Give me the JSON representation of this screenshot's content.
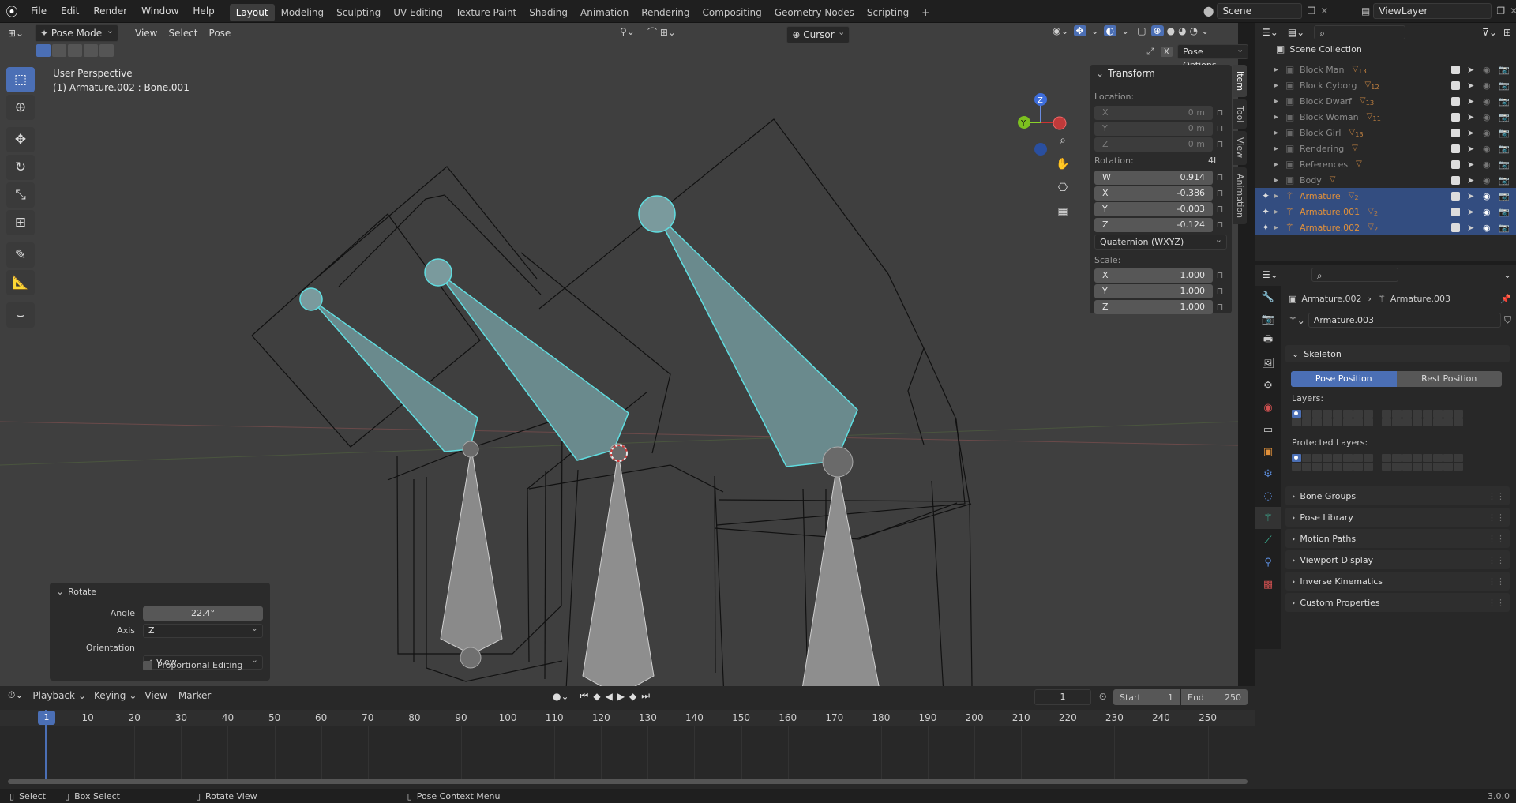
{
  "top_menu": {
    "items": [
      "File",
      "Edit",
      "Render",
      "Window",
      "Help"
    ],
    "workspaces": [
      "Layout",
      "Modeling",
      "Sculpting",
      "UV Editing",
      "Texture Paint",
      "Shading",
      "Animation",
      "Rendering",
      "Compositing",
      "Geometry Nodes",
      "Scripting"
    ],
    "active_workspace": "Layout",
    "scene": "Scene",
    "view_layer": "ViewLayer"
  },
  "viewport_header": {
    "mode": "Pose Mode",
    "menus": [
      "View",
      "Select",
      "Pose"
    ],
    "pivot": "Cursor",
    "pose_options": "Pose Options"
  },
  "viewport": {
    "view_name": "User Perspective",
    "object_info": "(1) Armature.002 : Bone.001",
    "gizmo_labels": {
      "z": "Z",
      "y": "Y"
    }
  },
  "npanel": {
    "title": "Transform",
    "location_label": "Location:",
    "location": [
      {
        "axis": "X",
        "value": "0 m"
      },
      {
        "axis": "Y",
        "value": "0 m"
      },
      {
        "axis": "Z",
        "value": "0 m"
      }
    ],
    "rotation_label": "Rotation:",
    "rotation_mode_tag": "4L",
    "rotation": [
      {
        "axis": "W",
        "value": "0.914"
      },
      {
        "axis": "X",
        "value": "-0.386"
      },
      {
        "axis": "Y",
        "value": "-0.003"
      },
      {
        "axis": "Z",
        "value": "-0.124"
      }
    ],
    "rotation_mode": "Quaternion (WXYZ)",
    "scale_label": "Scale:",
    "scale": [
      {
        "axis": "X",
        "value": "1.000"
      },
      {
        "axis": "Y",
        "value": "1.000"
      },
      {
        "axis": "Z",
        "value": "1.000"
      }
    ],
    "tabs": [
      "Item",
      "Tool",
      "View",
      "Animation"
    ]
  },
  "operator_panel": {
    "title": "Rotate",
    "angle_label": "Angle",
    "angle": "22.4°",
    "axis_label": "Axis",
    "axis": "Z",
    "orientation_label": "Orientation",
    "orientation": "View",
    "proportional": "Proportional Editing"
  },
  "outliner": {
    "root": "Scene Collection",
    "items": [
      {
        "name": "Block Man",
        "count": "13",
        "selected": false
      },
      {
        "name": "Block Cyborg",
        "count": "12",
        "selected": false
      },
      {
        "name": "Block Dwarf",
        "count": "13",
        "selected": false
      },
      {
        "name": "Block Woman",
        "count": "11",
        "selected": false
      },
      {
        "name": "Block Girl",
        "count": "13",
        "selected": false
      },
      {
        "name": "Rendering",
        "count": "",
        "selected": false
      },
      {
        "name": "References",
        "count": "",
        "selected": false
      },
      {
        "name": "Body",
        "count": "",
        "selected": false
      },
      {
        "name": "Armature",
        "count": "2",
        "selected": true
      },
      {
        "name": "Armature.001",
        "count": "2",
        "selected": true
      },
      {
        "name": "Armature.002",
        "count": "2",
        "selected": true
      }
    ]
  },
  "properties": {
    "breadcrumb_object": "Armature.002",
    "breadcrumb_data": "Armature.003",
    "datablock": "Armature.003",
    "skeleton": "Skeleton",
    "pose_position": "Pose Position",
    "rest_position": "Rest Position",
    "layers": "Layers:",
    "protected_layers": "Protected Layers:",
    "sections": [
      "Bone Groups",
      "Pose Library",
      "Motion Paths",
      "Viewport Display",
      "Inverse Kinematics",
      "Custom Properties"
    ]
  },
  "timeline": {
    "menus": [
      "Playback",
      "Keying",
      "View",
      "Marker"
    ],
    "current_frame": "1",
    "start_label": "Start",
    "start": "1",
    "end_label": "End",
    "end": "250",
    "ticks": [
      "1",
      "10",
      "20",
      "30",
      "40",
      "50",
      "60",
      "70",
      "80",
      "90",
      "100",
      "110",
      "120",
      "130",
      "140",
      "150",
      "160",
      "170",
      "180",
      "190",
      "200",
      "210",
      "220",
      "230",
      "240",
      "250"
    ]
  },
  "status_bar": {
    "select": "Select",
    "box_select": "Box Select",
    "rotate_view": "Rotate View",
    "context_menu": "Pose Context Menu",
    "version": "3.0.0"
  },
  "colors": {
    "accent": "#4b6fb5",
    "bone_select": "#5fdde0",
    "viewport_bg": "#3f3f3f"
  }
}
